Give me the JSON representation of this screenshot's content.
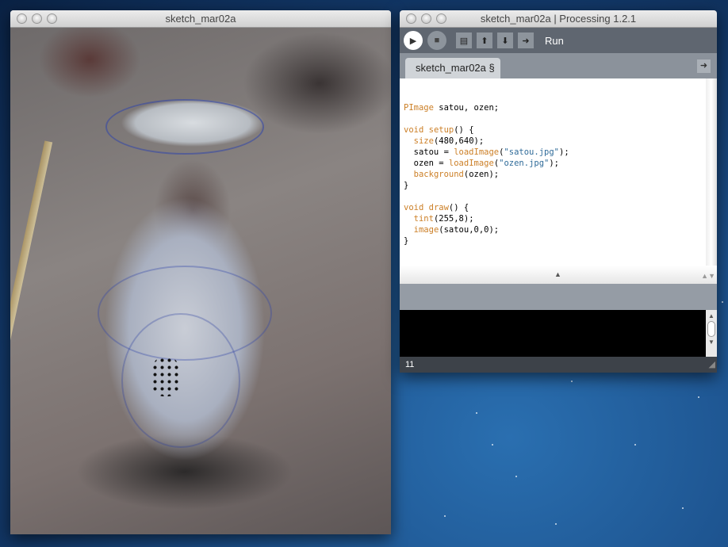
{
  "sketch_window": {
    "title": "sketch_mar02a"
  },
  "ide_window": {
    "title": "sketch_mar02a | Processing 1.2.1",
    "toolbar": {
      "run_label": "Run",
      "buttons": [
        "run",
        "stop",
        "new",
        "open",
        "save",
        "export"
      ]
    },
    "tab": {
      "label": "sketch_mar02a §"
    },
    "code": [
      [
        [
          "kw",
          "PImage"
        ],
        [
          "t",
          " satou, ozen;"
        ]
      ],
      [],
      [
        [
          "kw",
          "void"
        ],
        [
          "t",
          " "
        ],
        [
          "kw",
          "setup"
        ],
        [
          "t",
          "() {"
        ]
      ],
      [
        [
          "t",
          "  "
        ],
        [
          "kw",
          "size"
        ],
        [
          "t",
          "(480,640);"
        ]
      ],
      [
        [
          "t",
          "  satou = "
        ],
        [
          "kw",
          "loadImage"
        ],
        [
          "t",
          "("
        ],
        [
          "str",
          "\"satou.jpg\""
        ],
        [
          "t",
          ");"
        ]
      ],
      [
        [
          "t",
          "  ozen = "
        ],
        [
          "kw",
          "loadImage"
        ],
        [
          "t",
          "("
        ],
        [
          "str",
          "\"ozen.jpg\""
        ],
        [
          "t",
          ");"
        ]
      ],
      [
        [
          "t",
          "  "
        ],
        [
          "kw",
          "background"
        ],
        [
          "t",
          "(ozen);"
        ]
      ],
      [
        [
          "t",
          "}"
        ]
      ],
      [],
      [
        [
          "kw",
          "void"
        ],
        [
          "t",
          " "
        ],
        [
          "kw",
          "draw"
        ],
        [
          "t",
          "() {"
        ]
      ],
      [
        [
          "t",
          "  "
        ],
        [
          "kw",
          "tint"
        ],
        [
          "t",
          "(255,8);"
        ]
      ],
      [
        [
          "t",
          "  "
        ],
        [
          "kw",
          "image"
        ],
        [
          "t",
          "(satou,0,0);"
        ]
      ],
      [
        [
          "t",
          "}"
        ]
      ]
    ],
    "status": {
      "line_number": "11"
    }
  },
  "colors": {
    "keyword": "#cc7f26",
    "string": "#2f6b99",
    "toolbar": "#5f6670"
  }
}
